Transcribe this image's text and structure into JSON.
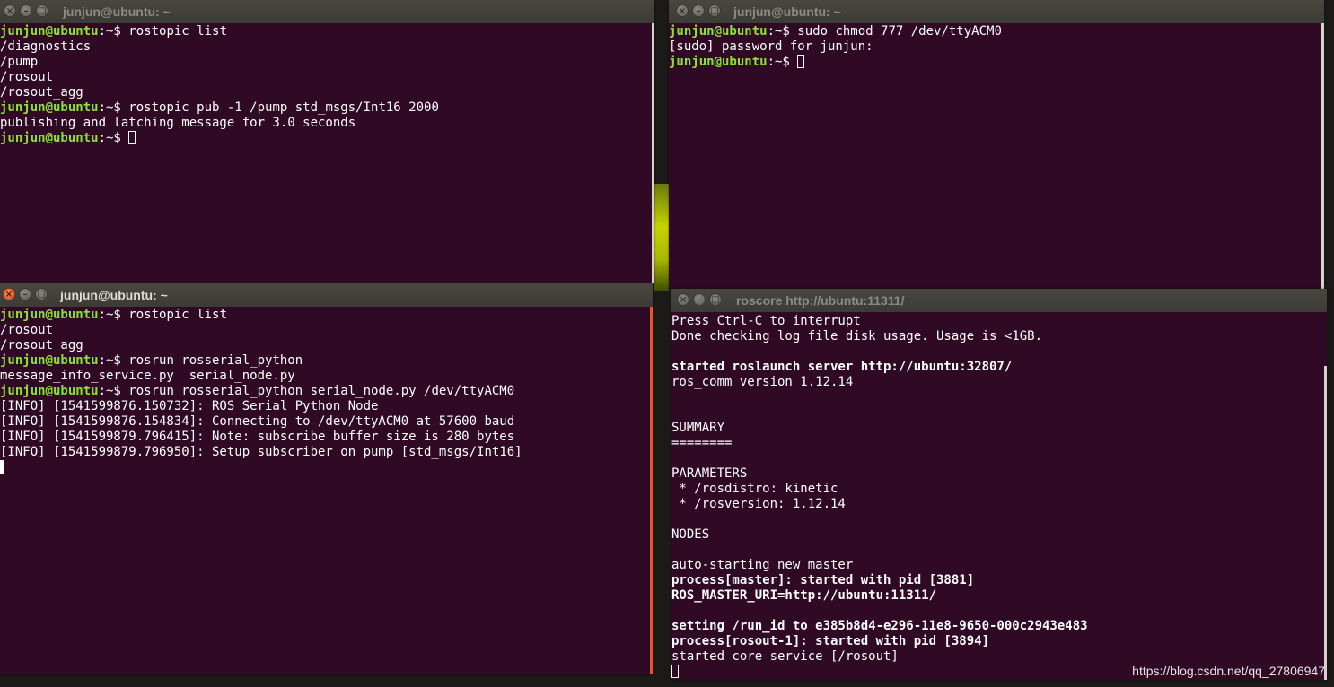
{
  "windows": {
    "top_left": {
      "title": "junjun@ubuntu: ~",
      "lines": [
        {
          "prompt_user": "junjun@ubuntu",
          "prompt_path": ":~$ ",
          "cmd": "rostopic list"
        },
        {
          "out": "/diagnostics"
        },
        {
          "out": "/pump"
        },
        {
          "out": "/rosout"
        },
        {
          "out": "/rosout_agg"
        },
        {
          "prompt_user": "junjun@ubuntu",
          "prompt_path": ":~$ ",
          "cmd": "rostopic pub -1 /pump std_msgs/Int16 2000"
        },
        {
          "out": "publishing and latching message for 3.0 seconds"
        },
        {
          "prompt_user": "junjun@ubuntu",
          "prompt_path": ":~$ ",
          "cmd": ""
        }
      ]
    },
    "top_right": {
      "title": "junjun@ubuntu: ~",
      "lines": [
        {
          "prompt_user": "junjun@ubuntu",
          "prompt_path": ":~$ ",
          "cmd": "sudo chmod 777 /dev/ttyACM0"
        },
        {
          "out": "[sudo] password for junjun:"
        },
        {
          "prompt_user": "junjun@ubuntu",
          "prompt_path": ":~$ ",
          "cmd": ""
        }
      ]
    },
    "bottom_left": {
      "title": "junjun@ubuntu: ~",
      "lines": [
        {
          "prompt_user": "junjun@ubuntu",
          "prompt_path": ":~$ ",
          "cmd": "rostopic list"
        },
        {
          "out": "/rosout"
        },
        {
          "out": "/rosout_agg"
        },
        {
          "prompt_user": "junjun@ubuntu",
          "prompt_path": ":~$ ",
          "cmd": "rosrun rosserial_python"
        },
        {
          "out": "message_info_service.py  serial_node.py"
        },
        {
          "prompt_user": "junjun@ubuntu",
          "prompt_path": ":~$ ",
          "cmd": "rosrun rosserial_python serial_node.py /dev/ttyACM0"
        },
        {
          "out": "[INFO] [1541599876.150732]: ROS Serial Python Node"
        },
        {
          "out": "[INFO] [1541599876.154834]: Connecting to /dev/ttyACM0 at 57600 baud"
        },
        {
          "out": "[INFO] [1541599879.796415]: Note: subscribe buffer size is 280 bytes"
        },
        {
          "out": "[INFO] [1541599879.796950]: Setup subscriber on pump [std_msgs/Int16]"
        }
      ]
    },
    "bottom_right": {
      "title": "roscore http://ubuntu:11311/",
      "lines": [
        {
          "out": "Press Ctrl-C to interrupt"
        },
        {
          "out": "Done checking log file disk usage. Usage is <1GB."
        },
        {
          "out": ""
        },
        {
          "out": "started roslaunch server http://ubuntu:32807/",
          "bold": true
        },
        {
          "out": "ros_comm version 1.12.14"
        },
        {
          "out": ""
        },
        {
          "out": ""
        },
        {
          "out": "SUMMARY"
        },
        {
          "out": "========"
        },
        {
          "out": ""
        },
        {
          "out": "PARAMETERS"
        },
        {
          "out": " * /rosdistro: kinetic"
        },
        {
          "out": " * /rosversion: 1.12.14"
        },
        {
          "out": ""
        },
        {
          "out": "NODES"
        },
        {
          "out": ""
        },
        {
          "out": "auto-starting new master"
        },
        {
          "out": "process[master]: started with pid [3881]",
          "bold": true
        },
        {
          "out": "ROS_MASTER_URI=http://ubuntu:11311/",
          "bold": true
        },
        {
          "out": ""
        },
        {
          "out": "setting /run_id to e385b8d4-e296-11e8-9650-000c2943e483",
          "bold": true
        },
        {
          "out": "process[rosout-1]: started with pid [3894]",
          "bold": true
        },
        {
          "out": "started core service [/rosout]"
        }
      ]
    }
  },
  "watermark": "https://blog.csdn.net/qq_27806947",
  "colors": {
    "terminal_bg": "#300a24",
    "prompt_user": "#8ae234",
    "prompt_path": "#ffffff",
    "text": "#ffffff",
    "titlebar": "#3c3b37"
  },
  "icons": {
    "close": "close-icon",
    "minimize": "minimize-icon",
    "maximize": "maximize-icon"
  }
}
